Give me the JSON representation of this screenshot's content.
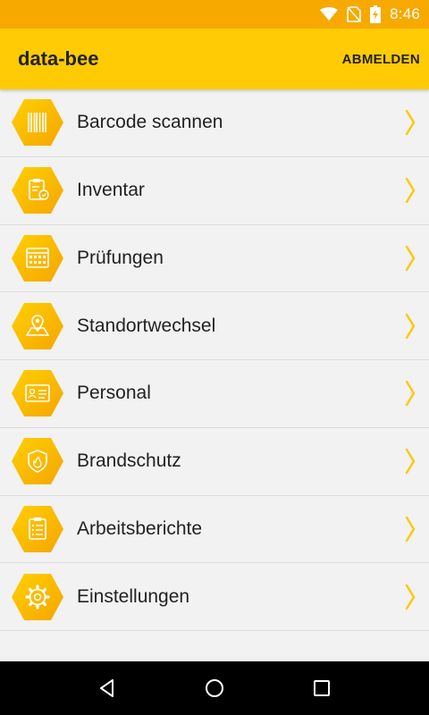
{
  "status_bar": {
    "time": "8:46",
    "icons": [
      "wifi-icon",
      "no-sim-icon",
      "battery-charging-icon"
    ]
  },
  "app_bar": {
    "title": "data-bee",
    "action_label": "ABMELDEN"
  },
  "menu": {
    "items": [
      {
        "label": "Barcode scannen",
        "icon": "barcode-icon"
      },
      {
        "label": "Inventar",
        "icon": "clipboard-check-icon"
      },
      {
        "label": "Prüfungen",
        "icon": "calendar-icon"
      },
      {
        "label": "Standortwechsel",
        "icon": "map-pin-icon"
      },
      {
        "label": "Personal",
        "icon": "id-card-icon"
      },
      {
        "label": "Brandschutz",
        "icon": "fire-shield-icon"
      },
      {
        "label": "Arbeitsberichte",
        "icon": "report-list-icon"
      },
      {
        "label": "Einstellungen",
        "icon": "gear-icon"
      }
    ]
  },
  "nav_bar": {
    "buttons": [
      "back-icon",
      "home-icon",
      "recents-icon"
    ]
  },
  "colors": {
    "status_bar": "#f7a900",
    "app_bar": "#ffcb05",
    "hex_light": "#ffd000",
    "hex_dark": "#f5a500",
    "chevron": "#ffc800"
  }
}
